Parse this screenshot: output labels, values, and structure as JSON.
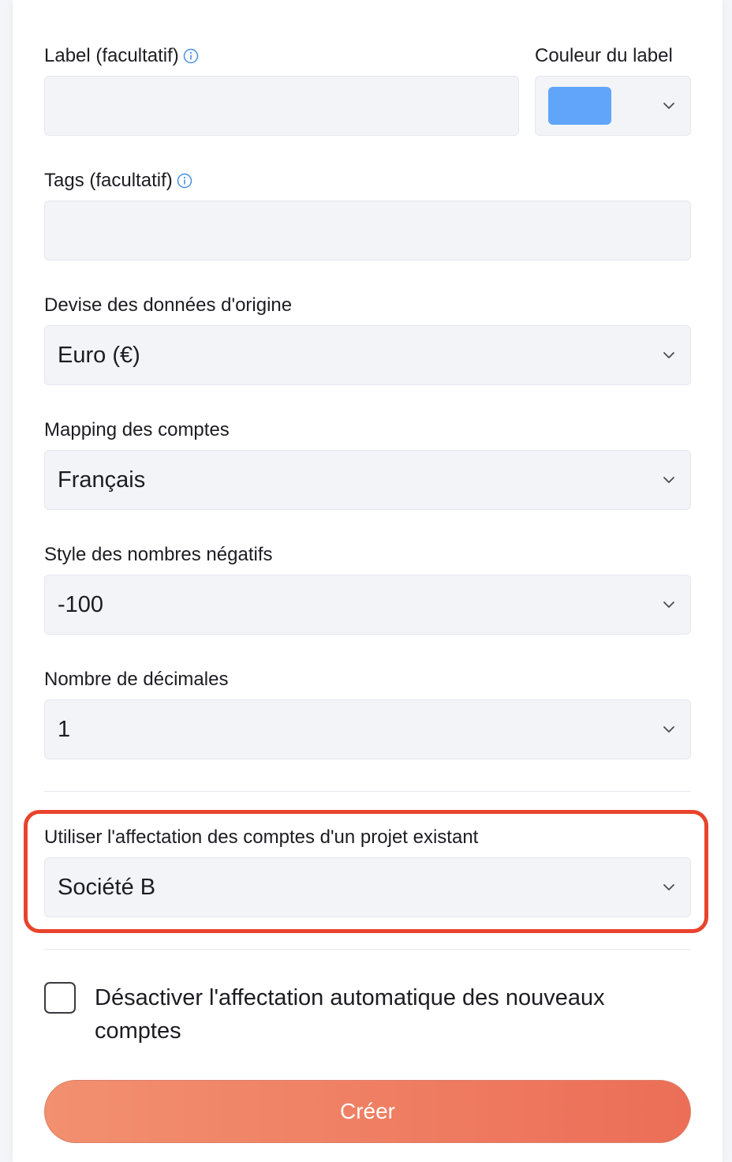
{
  "colors": {
    "label_color_swatch": "#60a5fa",
    "highlight_border": "#e8442d",
    "button_gradient_start": "#f2906f",
    "button_gradient_end": "#ec6e57",
    "info_icon": "#4a90e2"
  },
  "form": {
    "label_field": {
      "label": "Label (facultatif)",
      "icon": "info-icon",
      "value": ""
    },
    "label_color": {
      "label": "Couleur du label",
      "icon": "chevron-down-icon"
    },
    "tags_field": {
      "label": "Tags (facultatif)",
      "icon": "info-icon",
      "value": ""
    },
    "currency": {
      "label": "Devise des données d'origine",
      "value": "Euro (€)"
    },
    "account_mapping": {
      "label": "Mapping des comptes",
      "value": "Français"
    },
    "negative_style": {
      "label": "Style des nombres négatifs",
      "value": "-100"
    },
    "decimals": {
      "label": "Nombre de décimales",
      "value": "1"
    },
    "existing_project": {
      "label": "Utiliser l'affectation des comptes d'un projet existant",
      "value": "Société B"
    },
    "disable_auto": {
      "label": "Désactiver l'affectation automatique des nouveaux comptes",
      "checked": false
    },
    "submit_label": "Créer"
  }
}
